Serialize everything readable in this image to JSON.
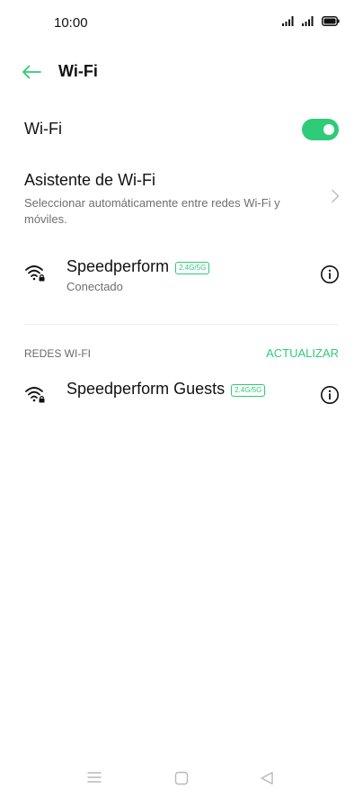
{
  "status_bar": {
    "time": "10:00",
    "icons": [
      "signal-icon",
      "signal-icon",
      "battery-icon"
    ]
  },
  "app_bar": {
    "title": "Wi-Fi",
    "back_icon": "arrow-left-icon"
  },
  "wifi_toggle": {
    "label": "Wi-Fi",
    "on": true
  },
  "assistant": {
    "title": "Asistente de Wi-Fi",
    "description": "Seleccionar automáticamente entre redes Wi-Fi y móviles."
  },
  "connected_network": {
    "name": "Speedperform",
    "band": "2.4G/5G",
    "status": "Conectado"
  },
  "networks_section": {
    "title": "REDES WI-FI",
    "refresh_label": "ACTUALIZAR",
    "items": [
      {
        "name": "Speedperform Guests",
        "band": "2.4G/5G"
      }
    ]
  },
  "colors": {
    "accent": "#2ecb79",
    "text_primary": "#111111",
    "text_secondary": "#6f6f6f"
  },
  "nav_bar": {
    "icons": [
      "menu-icon",
      "home-icon",
      "back-icon"
    ]
  }
}
